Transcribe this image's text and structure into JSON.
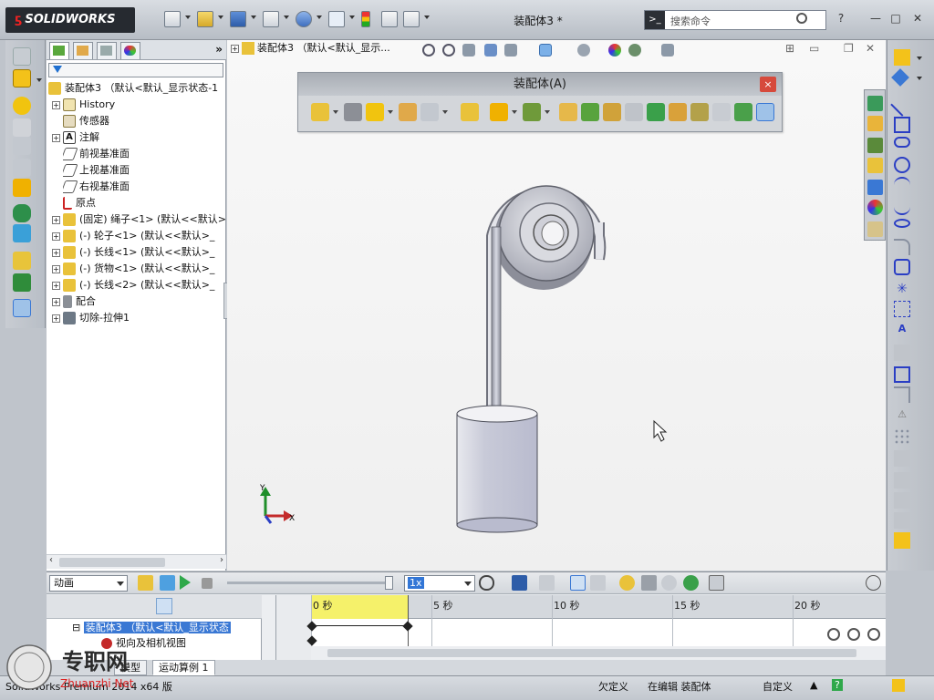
{
  "app": {
    "logo_text": "SOLIDWORKS",
    "document_title": "装配体3 *"
  },
  "search": {
    "placeholder": "搜索命令"
  },
  "feature_tree": {
    "root": "装配体3 （默认<默认_显示状态-1",
    "items": [
      {
        "label": "History",
        "expandable": true
      },
      {
        "label": "传感器",
        "expandable": false
      },
      {
        "label": "注解",
        "expandable": true
      },
      {
        "label": "前视基准面",
        "expandable": false
      },
      {
        "label": "上视基准面",
        "expandable": false
      },
      {
        "label": "右视基准面",
        "expandable": false
      },
      {
        "label": "原点",
        "expandable": false
      },
      {
        "label": "(固定) 绳子<1> (默认<<默认>",
        "expandable": true
      },
      {
        "label": "(-) 轮子<1> (默认<<默认>_",
        "expandable": true
      },
      {
        "label": "(-) 长线<1> (默认<<默认>_",
        "expandable": true
      },
      {
        "label": "(-) 货物<1> (默认<<默认>_",
        "expandable": true
      },
      {
        "label": "(-) 长线<2> (默认<<默认>_",
        "expandable": true
      },
      {
        "label": "配合",
        "expandable": true
      },
      {
        "label": "切除-拉伸1",
        "expandable": true
      }
    ]
  },
  "graphics": {
    "tree_label": "装配体3 （默认<默认_显示...",
    "axis_y": "Y",
    "axis_x": "X"
  },
  "float_toolbar": {
    "title": "装配体(A)",
    "close": "×"
  },
  "motion": {
    "study_type": "动画",
    "speed": "1x",
    "tree_root": "装配体3 （默认<默认_显示状态",
    "tree_child": "视向及相机视图",
    "time_labels": [
      "0 秒",
      "5 秒",
      "10 秒",
      "15 秒",
      "20 秒"
    ],
    "tabs": [
      "模型",
      "运动算例 1"
    ]
  },
  "status": {
    "app_version": "SolidWorks Premium 2014 x64 版",
    "units": "欠定义",
    "editing": "在编辑 装配体",
    "custom": "自定义",
    "help": "?"
  },
  "watermark": {
    "text": "专职网",
    "sub": "Zhuanzhi Net"
  },
  "colors": {
    "accent": "#3a78d4",
    "timeline_highlight": "#f5f16a",
    "model_gray": "#c9cbd6",
    "logo_red": "#e22222"
  }
}
